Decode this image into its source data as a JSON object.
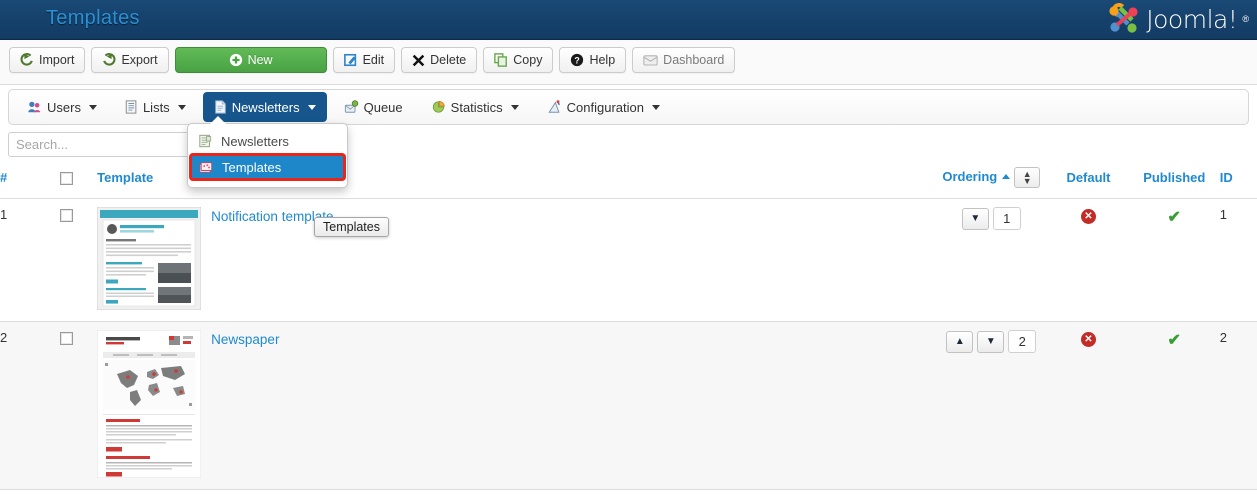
{
  "header": {
    "title": "Templates",
    "brand": "Joomla!",
    "brand_mark": "®"
  },
  "toolbar": {
    "buttons": [
      {
        "label": "Import",
        "icon": "import-icon"
      },
      {
        "label": "Export",
        "icon": "export-icon"
      },
      {
        "label": "New",
        "icon": "plus-circle-icon"
      },
      {
        "label": "Edit",
        "icon": "pencil-square-icon"
      },
      {
        "label": "Delete",
        "icon": "x-mark-icon"
      },
      {
        "label": "Copy",
        "icon": "copy-icon"
      },
      {
        "label": "Help",
        "icon": "question-circle-icon"
      },
      {
        "label": "Dashboard",
        "icon": "dashboard-icon"
      }
    ]
  },
  "subnav": {
    "items": [
      {
        "label": "Users",
        "icon": "users-icon",
        "caret": true,
        "active": false
      },
      {
        "label": "Lists",
        "icon": "list-icon",
        "caret": true,
        "active": false
      },
      {
        "label": "Newsletters",
        "icon": "document-icon",
        "caret": true,
        "active": true
      },
      {
        "label": "Queue",
        "icon": "queue-gear-icon",
        "caret": false,
        "active": false
      },
      {
        "label": "Statistics",
        "icon": "statistics-icon",
        "caret": true,
        "active": false
      },
      {
        "label": "Configuration",
        "icon": "configuration-icon",
        "caret": true,
        "active": false
      }
    ]
  },
  "dropdown": {
    "items": [
      {
        "label": "Newsletters",
        "icon": "newsletter-page-icon",
        "selected": false
      },
      {
        "label": "Templates",
        "icon": "templates-stack-icon",
        "selected": true
      }
    ]
  },
  "tooltip": {
    "text": "Templates"
  },
  "search": {
    "placeholder": "Search...",
    "value": ""
  },
  "table": {
    "headers": {
      "num": "#",
      "check": "",
      "template": "Template",
      "ordering": "Ordering",
      "default": "Default",
      "published": "Published",
      "id": "ID"
    },
    "rows": [
      {
        "num": "1",
        "name": "Notification template",
        "thumb": "notification-template-thumb",
        "order_value": "1",
        "order_up": false,
        "order_down": true,
        "default": "no",
        "published": "yes",
        "id": "1"
      },
      {
        "num": "2",
        "name": "Newspaper",
        "thumb": "newspaper-template-thumb",
        "order_value": "2",
        "order_up": true,
        "order_down": true,
        "default": "no",
        "published": "yes",
        "id": "2"
      }
    ]
  },
  "colors": {
    "header_blue": "#15416b",
    "title_blue": "#2a8fd4",
    "link_blue": "#1f8ad0",
    "active_nav": "#16568c",
    "selected_item": "#1d87c9",
    "highlight_red": "#e8261c",
    "green_button": "#4aa244",
    "status_no_red": "#c32b26",
    "status_yes_green": "#3b9e35"
  }
}
